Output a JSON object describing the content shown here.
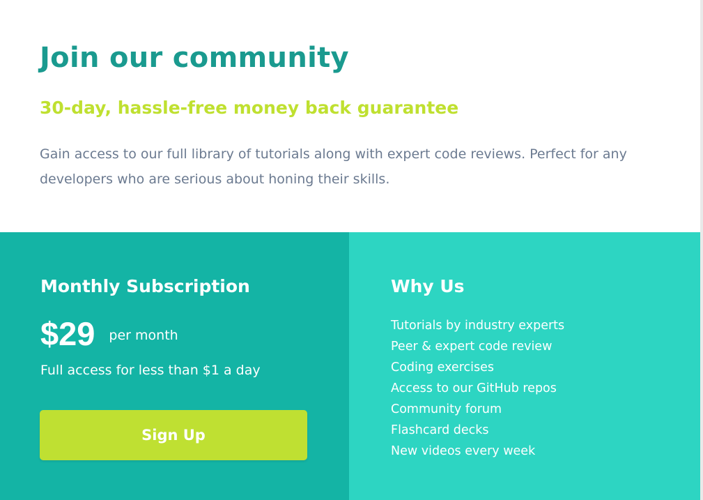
{
  "hero": {
    "title": "Join our community",
    "subtitle": "30-day, hassle-free money back guarantee",
    "description": "Gain access to our full library of tutorials along with expert code reviews. Perfect for any developers who are serious about honing their skills."
  },
  "subscription": {
    "heading": "Monthly Subscription",
    "price": "$29",
    "period": "per month",
    "note": "Full access for less than $1 a day",
    "cta_label": "Sign Up"
  },
  "why_us": {
    "heading": "Why Us",
    "items": [
      "Tutorials by industry experts",
      "Peer & expert code review",
      "Coding exercises",
      "Access to our GitHub repos",
      "Community forum",
      "Flashcard decks",
      "New videos every week"
    ]
  },
  "colors": {
    "title": "#1a9a8f",
    "subtitle": "#bfe030",
    "description": "#6b7a90",
    "subscription_panel": "#14b4a5",
    "why_us_panel": "#2dd5c2",
    "cta_button": "#bfe032"
  }
}
